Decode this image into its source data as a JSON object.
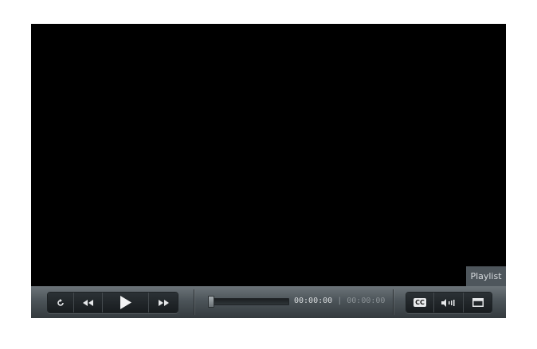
{
  "player": {
    "playlist_label": "Playlist",
    "time": {
      "current": "00:00:00",
      "separator": "|",
      "duration": "00:00:00"
    },
    "seek": {
      "position_fraction": 0.0
    },
    "captions_label": "CC",
    "icons": {
      "replay": "replay-icon",
      "rewind": "rewind-icon",
      "play": "play-icon",
      "fast_forward": "fast-forward-icon",
      "captions": "closed-captions-icon",
      "volume": "volume-icon",
      "fullscreen": "fullscreen-icon"
    },
    "colors": {
      "video_background": "#000000",
      "controls_bar": "#4c5459",
      "playlist_tab": "#4e565c"
    }
  }
}
